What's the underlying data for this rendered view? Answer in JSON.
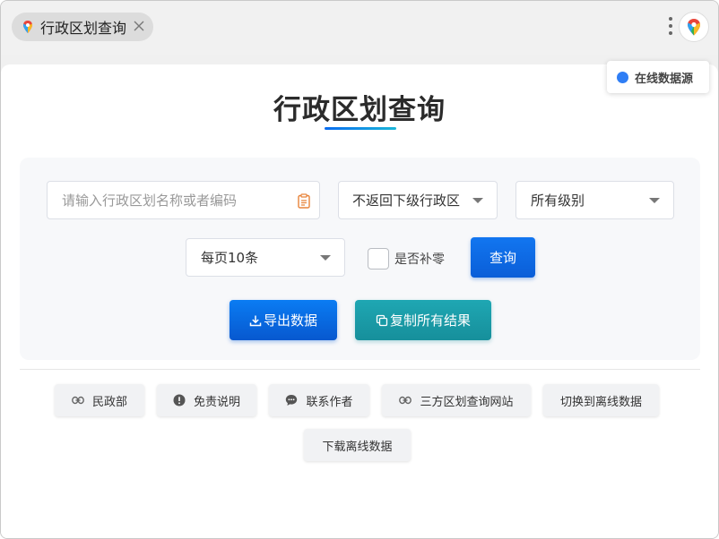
{
  "tab": {
    "title": "行政区划查询"
  },
  "badge": {
    "label": "在线数据源"
  },
  "page": {
    "title": "行政区划查询"
  },
  "form": {
    "search_placeholder": "请输入行政区划名称或者编码",
    "search_value": "",
    "subordinate_select": "不返回下级行政区",
    "level_select": "所有级别",
    "page_size_select": "每页10条",
    "zero_pad_label": "是否补零",
    "zero_pad_checked": false,
    "query_label": "查询"
  },
  "actions": {
    "export_label": "导出数据",
    "copy_label": "复制所有结果"
  },
  "links": {
    "minzheng": "民政部",
    "mianze": "免责说明",
    "contact": "联系作者",
    "third_party": "三方区划查询网站",
    "switch_offline": "切换到离线数据",
    "download_offline": "下载离线数据"
  },
  "colors": {
    "primary": "#0a6cf0",
    "teal": "#1a9aa6",
    "online_dot": "#2f7ef5"
  }
}
